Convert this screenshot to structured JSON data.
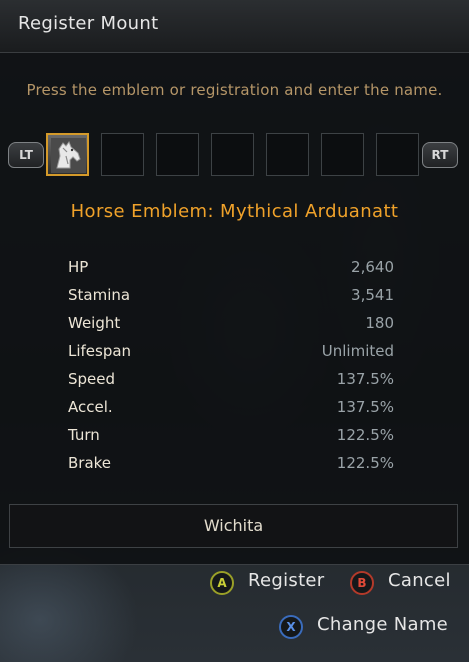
{
  "window": {
    "title": "Register Mount",
    "instruction": "Press the emblem or registration and enter the name."
  },
  "bumpers": {
    "left": "LT",
    "right": "RT"
  },
  "slots": {
    "count": 8,
    "selected_index": 0,
    "selected_icon": "horse-emblem-icon"
  },
  "emblem": {
    "name": "Horse Emblem: Mythical Arduanatt"
  },
  "stats": [
    {
      "label": "HP",
      "value": "2,640"
    },
    {
      "label": "Stamina",
      "value": "3,541"
    },
    {
      "label": "Weight",
      "value": "180"
    },
    {
      "label": "Lifespan",
      "value": "Unlimited"
    },
    {
      "label": "Speed",
      "value": "137.5%"
    },
    {
      "label": "Accel.",
      "value": "137.5%"
    },
    {
      "label": "Turn",
      "value": "122.5%"
    },
    {
      "label": "Brake",
      "value": "122.5%"
    }
  ],
  "name_field": {
    "value": "Wichita"
  },
  "actions": {
    "register": {
      "glyph": "A",
      "label": "Register"
    },
    "cancel": {
      "glyph": "B",
      "label": "Cancel"
    },
    "change_name": {
      "glyph": "X",
      "label": "Change Name"
    }
  },
  "colors": {
    "accent_orange": "#f0a22a",
    "instruction_tan": "#b59668",
    "selected_border": "#d49a2a"
  }
}
